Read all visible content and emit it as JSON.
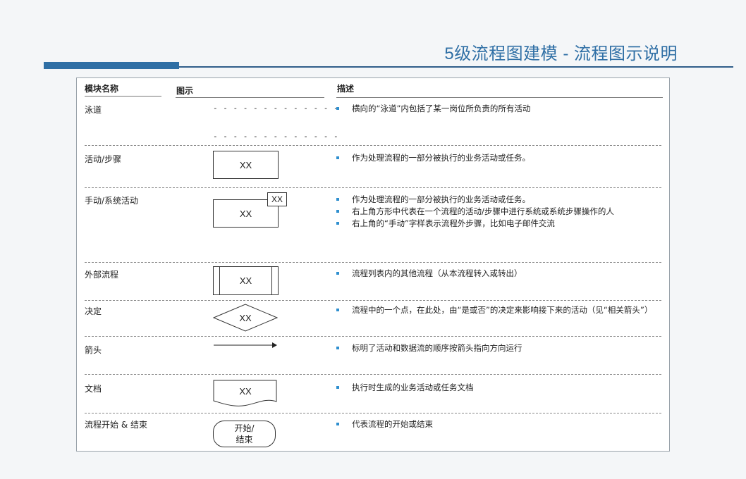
{
  "title": "5级流程图建模 - 流程图示说明",
  "headers": {
    "module": "模块名称",
    "diagram": "图示",
    "description": "描述"
  },
  "rows": [
    {
      "label": "泳道",
      "shape": "swimlane",
      "desc": [
        "横向的“泳道”内包括了某一岗位所负责的所有活动"
      ]
    },
    {
      "label": "活动/步骤",
      "shape": "activity",
      "shape_text": "XX",
      "desc": [
        "作为处理流程的一部分被执行的业务活动或任务。"
      ]
    },
    {
      "label": "手动/系统活动",
      "shape": "manual-system",
      "shape_text": "XX",
      "corner_text": "XX",
      "desc": [
        "作为处理流程的一部分被执行的业务活动或任务。",
        "右上角方形中代表在一个流程的活动/步骤中进行系统或系统步骤操作的人",
        "右上角的“手动”字样表示流程外步骤，比如电子邮件交流"
      ]
    },
    {
      "label": "外部流程",
      "shape": "external",
      "shape_text": "XX",
      "desc": [
        "流程列表内的其他流程（从本流程转入或转出）"
      ]
    },
    {
      "label": "决定",
      "shape": "decision",
      "shape_text": "XX",
      "desc": [
        "流程中的一个点，在此处，由“是或否”的决定来影响接下来的活动（见“相关箭头”）"
      ]
    },
    {
      "label": "箭头",
      "shape": "arrow",
      "desc": [
        "标明了活动和数据流的顺序按箭头指向方向运行"
      ]
    },
    {
      "label": "文档",
      "shape": "document",
      "shape_text": "XX",
      "desc": [
        "执行时生成的业务活动或任务文档"
      ]
    },
    {
      "label": "流程开始 & 结束",
      "shape": "terminator",
      "shape_text": "开始/\n结束",
      "desc": [
        "代表流程的开始或结束"
      ]
    }
  ],
  "colors": {
    "accent": "#2f6fa5",
    "bullet": "#2f8fcf",
    "rule": "#2f5d8a"
  }
}
